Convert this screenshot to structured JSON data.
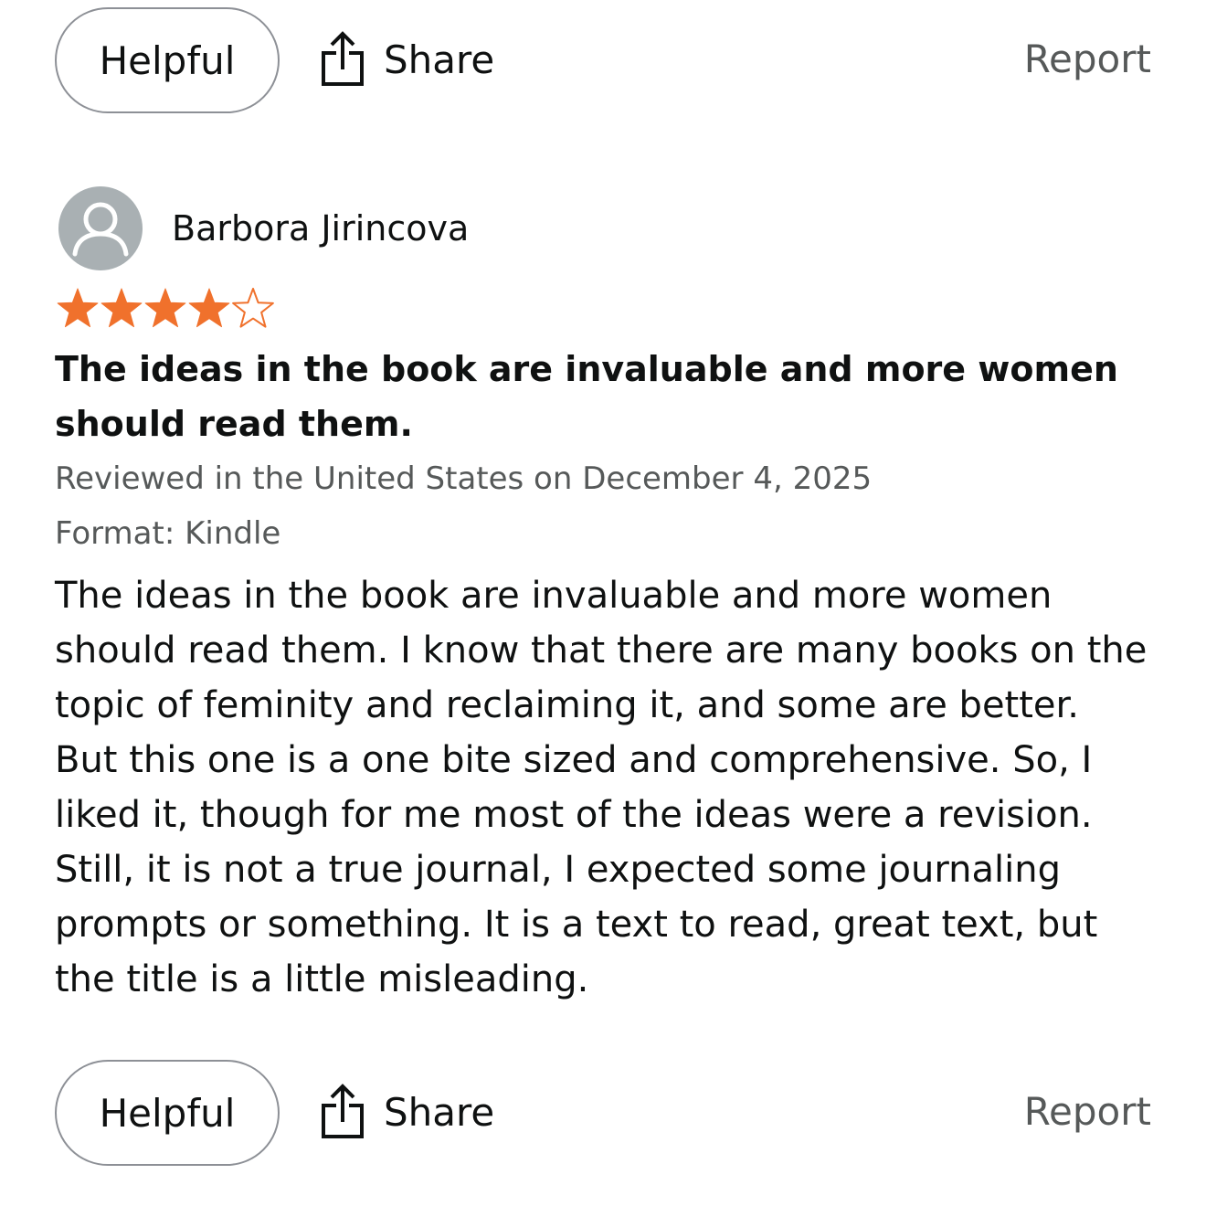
{
  "top_actions": {
    "helpful_label": "Helpful",
    "share_label": "Share",
    "report_label": "Report"
  },
  "review": {
    "reviewer_name": "Barbora Jirincova",
    "rating": 4,
    "rating_max": 5,
    "title": "The ideas in the book are invaluable and more women should read them.",
    "reviewed_in": "Reviewed in the United States on December 4, 2025",
    "format": "Format: Kindle",
    "body": "The ideas in the book are invaluable and more women should read them. I know that there are many books on the topic of feminity and reclaiming it, and some are better. But this one is a one bite sized and comprehensive. So, I liked it, though for me most of the ideas were a revision. Still, it is not a true journal, I expected some journaling prompts or something. It is a text to read, great text, but the title is a little misleading."
  },
  "bottom_actions": {
    "helpful_label": "Helpful",
    "share_label": "Share",
    "report_label": "Report"
  },
  "colors": {
    "star_fill": "#f0712c",
    "star_empty_stroke": "#f0712c",
    "button_border": "#8d9096",
    "muted_text": "#565959",
    "avatar_bg": "#a9b0b3"
  },
  "icons": {
    "share": "share-icon",
    "avatar": "user-avatar-icon",
    "star": "star-icon"
  }
}
